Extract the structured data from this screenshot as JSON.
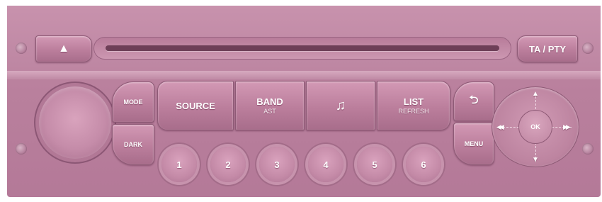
{
  "eject": {
    "icon": "eject-icon",
    "glyph": "▲"
  },
  "ta_pty": {
    "label": "TA / PTY"
  },
  "mode_dark": {
    "mode_label": "MODE",
    "dark_label": "DARK"
  },
  "main_buttons": [
    {
      "label": "SOURCE",
      "sub": ""
    },
    {
      "label": "BAND",
      "sub": "AST"
    },
    {
      "label": "♫",
      "sub": ""
    },
    {
      "label": "LIST",
      "sub": "REFRESH"
    }
  ],
  "back_menu": {
    "back_icon": "back-return-icon",
    "back_glyph": "⮌",
    "menu_label": "MENU"
  },
  "dpad": {
    "ok_label": "OK",
    "up_glyph": "▲",
    "down_glyph": "▼",
    "left_glyph": "◀◀",
    "right_glyph": "▶▶"
  },
  "presets": [
    "1",
    "2",
    "3",
    "4",
    "5",
    "6"
  ]
}
